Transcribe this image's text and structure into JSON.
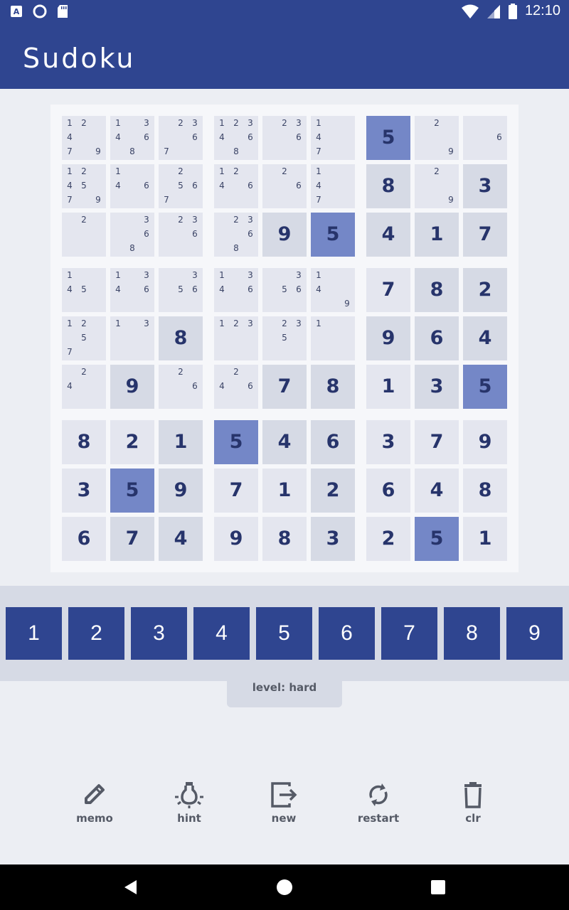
{
  "status_bar": {
    "time": "12:10",
    "left_icons": [
      "text-a-icon",
      "circle-icon",
      "sd-card-icon"
    ],
    "right_icons": [
      "wifi-icon",
      "cell-signal-icon",
      "battery-icon"
    ]
  },
  "app_bar": {
    "title": "Sudoku"
  },
  "colors": {
    "primary": "#2f4590",
    "cell_light": "#e4e6ef",
    "cell_mid": "#d6dae5",
    "cell_highlight": "#7487c7",
    "digit": "#27346b"
  },
  "board": {
    "legend": "value=number shown, memo=pencil candidates, bg: l=light m=mid h=highlighted",
    "rows": [
      [
        {
          "memo": [
            1,
            2,
            4,
            7,
            9
          ],
          "bg": "l"
        },
        {
          "memo": [
            1,
            3,
            4,
            6,
            8
          ],
          "bg": "l"
        },
        {
          "memo": [
            2,
            3,
            6,
            7
          ],
          "bg": "l"
        },
        {
          "memo": [
            1,
            2,
            3,
            4,
            6,
            8
          ],
          "bg": "l"
        },
        {
          "memo": [
            2,
            3,
            6
          ],
          "bg": "l"
        },
        {
          "memo": [
            1,
            4,
            7
          ],
          "bg": "l"
        },
        {
          "value": 5,
          "bg": "h"
        },
        {
          "memo": [
            2,
            9
          ],
          "bg": "l"
        },
        {
          "memo": [
            6
          ],
          "bg": "l"
        }
      ],
      [
        {
          "memo": [
            1,
            2,
            4,
            5,
            7,
            9
          ],
          "bg": "l"
        },
        {
          "memo": [
            1,
            4,
            6
          ],
          "bg": "l"
        },
        {
          "memo": [
            2,
            5,
            6,
            7
          ],
          "bg": "l"
        },
        {
          "memo": [
            1,
            2,
            4,
            6
          ],
          "bg": "l"
        },
        {
          "memo": [
            2,
            6
          ],
          "bg": "l"
        },
        {
          "memo": [
            1,
            4,
            7
          ],
          "bg": "l"
        },
        {
          "value": 8,
          "bg": "m"
        },
        {
          "memo": [
            2,
            9
          ],
          "bg": "l"
        },
        {
          "value": 3,
          "bg": "m"
        }
      ],
      [
        {
          "memo": [
            2
          ],
          "bg": "l"
        },
        {
          "memo": [
            3,
            6,
            8
          ],
          "bg": "l"
        },
        {
          "memo": [
            2,
            3,
            6
          ],
          "bg": "l"
        },
        {
          "memo": [
            2,
            3,
            6,
            8
          ],
          "bg": "l"
        },
        {
          "value": 9,
          "bg": "m"
        },
        {
          "value": 5,
          "bg": "h"
        },
        {
          "value": 4,
          "bg": "m"
        },
        {
          "value": 1,
          "bg": "m"
        },
        {
          "value": 7,
          "bg": "m"
        }
      ],
      [
        {
          "memo": [
            1,
            4,
            5
          ],
          "bg": "l"
        },
        {
          "memo": [
            1,
            3,
            4,
            6
          ],
          "bg": "l"
        },
        {
          "memo": [
            3,
            5,
            6
          ],
          "bg": "l"
        },
        {
          "memo": [
            1,
            3,
            4,
            6
          ],
          "bg": "l"
        },
        {
          "memo": [
            3,
            5,
            6
          ],
          "bg": "l"
        },
        {
          "memo": [
            1,
            4,
            9
          ],
          "bg": "l"
        },
        {
          "value": 7,
          "bg": "l"
        },
        {
          "value": 8,
          "bg": "m"
        },
        {
          "value": 2,
          "bg": "m"
        }
      ],
      [
        {
          "memo": [
            1,
            2,
            5,
            7
          ],
          "bg": "l"
        },
        {
          "memo": [
            1,
            3
          ],
          "bg": "l"
        },
        {
          "value": 8,
          "bg": "m"
        },
        {
          "memo": [
            1,
            2,
            3
          ],
          "bg": "l"
        },
        {
          "memo": [
            2,
            3,
            5
          ],
          "bg": "l"
        },
        {
          "memo": [
            1
          ],
          "bg": "l"
        },
        {
          "value": 9,
          "bg": "m"
        },
        {
          "value": 6,
          "bg": "m"
        },
        {
          "value": 4,
          "bg": "m"
        }
      ],
      [
        {
          "memo": [
            2,
            4
          ],
          "bg": "l"
        },
        {
          "value": 9,
          "bg": "m"
        },
        {
          "memo": [
            2,
            6
          ],
          "bg": "l"
        },
        {
          "memo": [
            2,
            4,
            6
          ],
          "bg": "l"
        },
        {
          "value": 7,
          "bg": "m"
        },
        {
          "value": 8,
          "bg": "m"
        },
        {
          "value": 1,
          "bg": "l"
        },
        {
          "value": 3,
          "bg": "m"
        },
        {
          "value": 5,
          "bg": "h"
        }
      ],
      [
        {
          "value": 8,
          "bg": "l"
        },
        {
          "value": 2,
          "bg": "l"
        },
        {
          "value": 1,
          "bg": "m"
        },
        {
          "value": 5,
          "bg": "h"
        },
        {
          "value": 4,
          "bg": "m"
        },
        {
          "value": 6,
          "bg": "m"
        },
        {
          "value": 3,
          "bg": "l"
        },
        {
          "value": 7,
          "bg": "l"
        },
        {
          "value": 9,
          "bg": "l"
        }
      ],
      [
        {
          "value": 3,
          "bg": "l"
        },
        {
          "value": 5,
          "bg": "h"
        },
        {
          "value": 9,
          "bg": "m"
        },
        {
          "value": 7,
          "bg": "l"
        },
        {
          "value": 1,
          "bg": "l"
        },
        {
          "value": 2,
          "bg": "m"
        },
        {
          "value": 6,
          "bg": "l"
        },
        {
          "value": 4,
          "bg": "l"
        },
        {
          "value": 8,
          "bg": "l"
        }
      ],
      [
        {
          "value": 6,
          "bg": "l"
        },
        {
          "value": 7,
          "bg": "m"
        },
        {
          "value": 4,
          "bg": "m"
        },
        {
          "value": 9,
          "bg": "l"
        },
        {
          "value": 8,
          "bg": "l"
        },
        {
          "value": 3,
          "bg": "m"
        },
        {
          "value": 2,
          "bg": "l"
        },
        {
          "value": 5,
          "bg": "h"
        },
        {
          "value": 1,
          "bg": "l"
        }
      ]
    ]
  },
  "number_pad": [
    "1",
    "2",
    "3",
    "4",
    "5",
    "6",
    "7",
    "8",
    "9"
  ],
  "level_label": "level: hard",
  "tools": [
    {
      "id": "memo",
      "label": "memo",
      "icon": "pencil-icon"
    },
    {
      "id": "hint",
      "label": "hint",
      "icon": "lightbulb-icon"
    },
    {
      "id": "new",
      "label": "new",
      "icon": "exit-arrow-icon"
    },
    {
      "id": "restart",
      "label": "restart",
      "icon": "refresh-icon"
    },
    {
      "id": "clr",
      "label": "clr",
      "icon": "trash-icon"
    }
  ],
  "nav_bar": [
    "back-icon",
    "home-icon",
    "recents-icon"
  ]
}
